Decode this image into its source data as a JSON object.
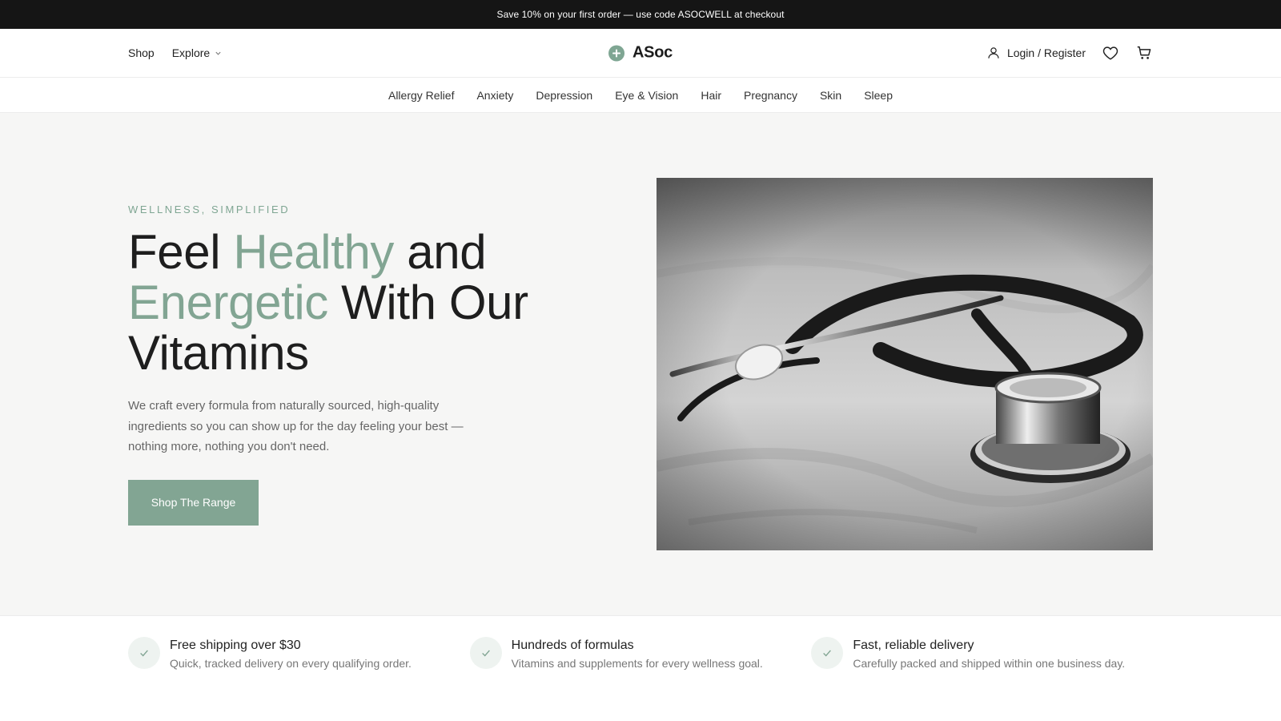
{
  "announcement": "Save 10% on your first order — use code ASOCWELL at checkout",
  "header": {
    "nav": [
      {
        "label": "Shop"
      },
      {
        "label": "Explore"
      }
    ],
    "logo_text": "ASoc",
    "login_label": "Login / Register",
    "icons": {
      "account": "user-icon",
      "wishlist": "heart-icon",
      "cart": "cart-icon",
      "logo": "plus-circle-icon",
      "dropdown": "chevron-down-icon"
    }
  },
  "categories": [
    "Allergy Relief",
    "Anxiety",
    "Depression",
    "Eye & Vision",
    "Hair",
    "Pregnancy",
    "Skin",
    "Sleep"
  ],
  "hero": {
    "eyebrow": "WELLNESS, SIMPLIFIED",
    "headline": {
      "part1": "Feel ",
      "accent1": "Healthy",
      "part2": " and",
      "accent2": "Energetic",
      "part3": " With Our",
      "part4": "Vitamins"
    },
    "lede": "We craft every formula from naturally sourced, high-quality ingredients so you can show up for the day feeling your best — nothing more, nothing you don't need.",
    "cta_label": "Shop The Range",
    "image": "stethoscope-photo"
  },
  "features": [
    {
      "title": "Free shipping over $30",
      "desc": "Quick, tracked delivery on every qualifying order."
    },
    {
      "title": "Hundreds of formulas",
      "desc": "Vitamins and supplements for every wellness goal."
    },
    {
      "title": "Fast, reliable delivery",
      "desc": "Carefully packed and shipped within one business day."
    }
  ],
  "colors": {
    "accent": "#82a593",
    "announce_bg": "#151515",
    "hero_bg": "#f6f6f5"
  }
}
